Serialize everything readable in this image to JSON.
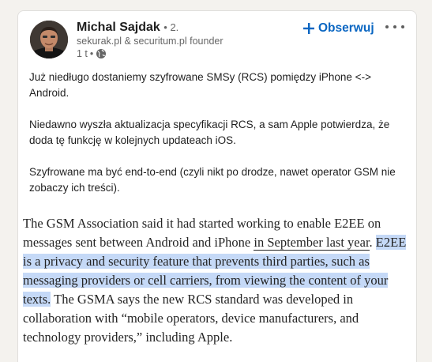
{
  "post": {
    "author_name": "Michal Sajdak",
    "degree": "• 2.",
    "headline": "sekurak.pl & securitum.pl founder",
    "time": "1 t",
    "time_sep": "•",
    "follow_label": "Obserwuj",
    "icons": {
      "follow": "plus-icon",
      "visibility": "globe-icon",
      "more": "more-icon"
    },
    "paragraphs": [
      "Już niedługo dostaniemy szyfrowane SMSy (RCS) pomiędzy iPhone <-> Android.",
      "Niedawno wyszła aktualizacja specyfikacji RCS, a sam Apple potwierdza, że doda tę funkcję w kolejnych updateach iOS.",
      "Szyfrowane ma być end-to-end (czyli nikt po drodze, nawet operator GSM nie zobaczy ich treści)."
    ]
  },
  "article": {
    "part1": "The GSM Association said it had started working to enable E2EE on messages sent between Android and iPhone ",
    "link": "in September last year",
    "part2": ".",
    "highlight": "E2EE is a privacy and security feature that prevents third parties, such as messaging providers or cell carriers, from viewing the content of your texts.",
    "part3": " The GSMA says the new RCS standard was developed in collaboration with “mobile operators, device manufacturers, and technology providers,” including Apple."
  },
  "colors": {
    "accent": "#0a66c2",
    "highlight": "#c5d9f7",
    "page_bg": "#f4f2ee"
  }
}
